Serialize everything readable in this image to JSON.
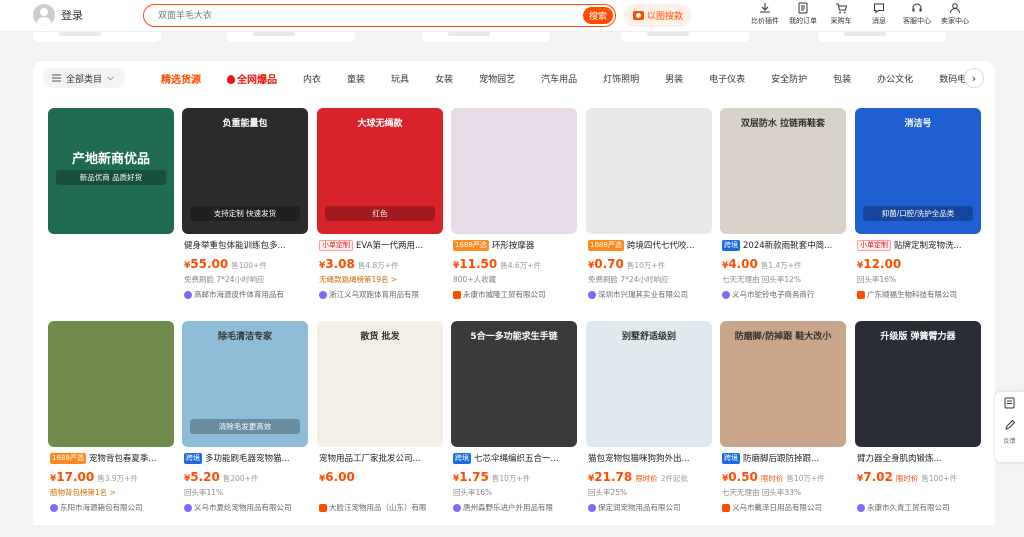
{
  "header": {
    "login_label": "登录",
    "search_placeholder": "双面羊毛大衣",
    "search_button": "搜索",
    "image_search": "以图搜款",
    "tools": [
      {
        "icon": "download-icon",
        "label": "比价插件"
      },
      {
        "icon": "order-icon",
        "label": "我的订单"
      },
      {
        "icon": "cart-icon",
        "label": "采购车"
      },
      {
        "icon": "message-icon",
        "label": "消息"
      },
      {
        "icon": "service-icon",
        "label": "客服中心"
      },
      {
        "icon": "seller-icon",
        "label": "卖家中心"
      }
    ]
  },
  "categories": {
    "all_label": "全部类目",
    "items": [
      "精选货源",
      "全网爆品",
      "内衣",
      "童装",
      "玩具",
      "女装",
      "宠物园艺",
      "汽车用品",
      "灯饰照明",
      "男装",
      "电子仪表",
      "安全防护",
      "包装",
      "办公文化",
      "数码电脑"
    ]
  },
  "products": [
    {
      "title": "",
      "price": "",
      "sold": "",
      "sub": "",
      "shop": "",
      "banner": "产地新商优品",
      "banner_sub": "新品优商 品质好货",
      "bg": "#1e6b4f"
    },
    {
      "tag": "",
      "title": "健身举重包体能训练包多...",
      "price": "55.00",
      "sold": "售100+件",
      "sub": "免费刷脸  7*24小时响应",
      "shop": "高邮市海源皮件体育用品有",
      "banner": "负重能量包",
      "banner_sub": "支持定制 快速发货",
      "bg": "#2b2b2b"
    },
    {
      "tag": "小单定制",
      "tag_class": "txd",
      "title": "EVA第一代两用...",
      "price": "3.08",
      "sold": "售4.8万+件",
      "sub": "无绳款跳绳榜第19名 >",
      "sub_class": "orange",
      "shop": "浙江义乌双跑体育用品有限",
      "banner": "大球无绳款",
      "banner_sub": "红色",
      "bg": "#d8232a"
    },
    {
      "tag": "1688严选",
      "tag_class": "t1688",
      "title": "环形按摩器",
      "price": "11.50",
      "sold": "售4.6万+件",
      "sub": "800+人收藏",
      "shop": "永康市城隆工贸有限公司",
      "banner": "",
      "banner_sub": "",
      "bg": "#e7dbe8"
    },
    {
      "tag": "1688严选",
      "tag_class": "t1688",
      "title": "跨境四代七代咬...",
      "price": "0.70",
      "sold": "售10万+件",
      "sub": "免费刷脸  7*24小时响应",
      "shop": "深圳市兴瑞其实业有限公司",
      "banner": "",
      "banner_sub": "",
      "bg": "#e9e9e9"
    },
    {
      "tag": "跨境",
      "tag_class": "tkj",
      "title": "2024新款雨靴套中简...",
      "price": "4.00",
      "sold": "售1.4万+件",
      "sub": "七天无理由  回头率12%",
      "shop": "义乌市驼铃电子商务商行",
      "banner": "双层防水 拉链雨鞋套",
      "banner_sub": "",
      "bg": "#d9d2c9"
    },
    {
      "tag": "小单定制",
      "tag_class": "txd",
      "title": "贴牌定制宠物洗...",
      "price": "12.00",
      "sold": "",
      "sub": "回头率16%",
      "shop": "广东顺福生物科技有限公司",
      "banner": "消洁号",
      "banner_sub": "抑菌/口腔/洗护全品类",
      "bg": "#1f5fd1"
    },
    {
      "tag": "1688严选",
      "tag_class": "t1688",
      "title": "宠物背包春夏季...",
      "price": "17.00",
      "sold": "售3.9万+件",
      "sub": "腊物背包榜第1名 >",
      "sub_class": "orange",
      "shop": "东阳市海源箱包有限公司",
      "banner": "",
      "banner_sub": "",
      "bg": "#6f8a4a"
    },
    {
      "tag": "跨境",
      "tag_class": "tkj",
      "title": "多功能刷毛器宠物猫...",
      "price": "5.20",
      "sold": "售200+件",
      "sub": "回头率11%",
      "shop": "义乌市夏纶宠物用品有限公司",
      "banner": "除毛清洁专家",
      "banner_sub": "清除毛发更高效",
      "bg": "#8fbcd6"
    },
    {
      "tag": "",
      "title": "宠物用品工厂家批发公司...",
      "price": "6.00",
      "sold": "",
      "sub": "",
      "shop": "大脸汪宠物用品（山东）有限",
      "banner": "散货 批发",
      "banner_sub": "",
      "bg": "#f3efe6"
    },
    {
      "tag": "跨境",
      "tag_class": "tkj",
      "title": "七芯伞绳编织五合一...",
      "price": "1.75",
      "sold": "售10万+件",
      "sub": "回头率16%",
      "shop": "唐州森野乐进户外用品有限",
      "banner": "5合一多功能求生手链",
      "banner_sub": "",
      "bg": "#3a3a3a"
    },
    {
      "tag": "",
      "title": "猫包宠物包猫咪狗狗外出...",
      "price": "21.78",
      "sold": "2件起批",
      "limit": "限时价",
      "sub": "回头率25%",
      "shop": "保定润宠物用品有限公司",
      "banner": "别墅舒适级别",
      "banner_sub": "",
      "bg": "#dfe9ee"
    },
    {
      "tag": "跨境",
      "tag_class": "tkj",
      "title": "防磨脚后跟防掉跟...",
      "price": "0.50",
      "sold": "售10万+件",
      "limit": "限时价",
      "sub": "七天无理由  回头率33%",
      "shop": "义乌市戴泽日用品有限公司",
      "banner": "防磨脚/防掉跟 鞋大改小",
      "banner_sub": "",
      "bg": "#c9a58c"
    },
    {
      "tag": "",
      "title": "臂力器全身肌肉锻炼...",
      "price": "7.02",
      "sold": "售100+件",
      "limit": "限时价",
      "sub": "",
      "shop": "永康市久青工贸有限公司",
      "banner": "升级版 弹簧臂力器",
      "banner_sub": "",
      "bg": "#2a2d35"
    }
  ],
  "float": {
    "feedback": "反馈"
  },
  "colors": {
    "brand": "#ff4d00",
    "cross_border": "#1a6be0"
  }
}
